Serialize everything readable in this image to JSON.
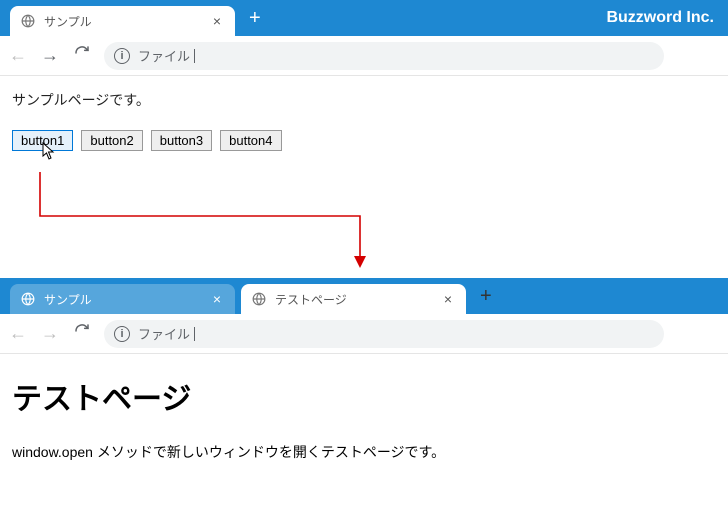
{
  "brand": "Buzzword Inc.",
  "browser1": {
    "tabs": [
      {
        "title": "サンプル",
        "active": true
      }
    ],
    "newtab": "+",
    "nav": {
      "back_disabled": true,
      "forward_disabled": false
    },
    "omnibox": {
      "label": "ファイル"
    },
    "page": {
      "text": "サンプルページです。",
      "buttons": [
        "button1",
        "button2",
        "button3",
        "button4"
      ]
    }
  },
  "browser2": {
    "tabs": [
      {
        "title": "サンプル",
        "active": false
      },
      {
        "title": "テストページ",
        "active": true
      }
    ],
    "newtab": "+",
    "nav": {
      "back_disabled": true,
      "forward_disabled": true
    },
    "omnibox": {
      "label": "ファイル"
    },
    "page": {
      "heading": "テストページ",
      "text": "window.open メソッドで新しいウィンドウを開くテストページです。"
    }
  }
}
